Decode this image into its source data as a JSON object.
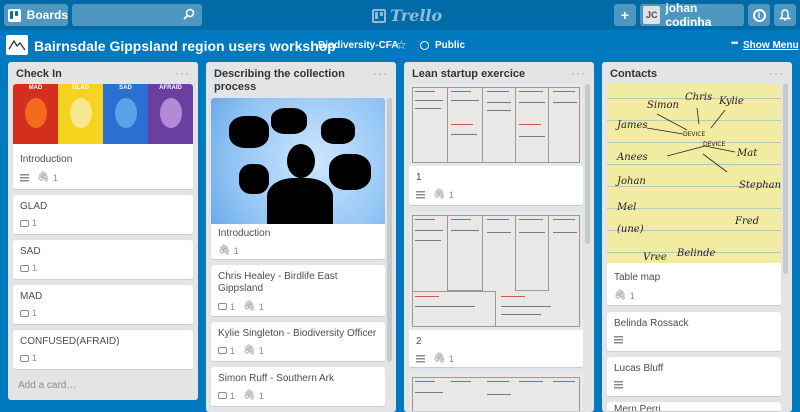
{
  "topbar": {
    "boards_label": "Boards",
    "search": {
      "placeholder": "",
      "value": ""
    },
    "logo_text": "Trello",
    "add_label": "+",
    "user": {
      "initials": "JC",
      "name": "johan codinha"
    },
    "info_label": "i",
    "bell_label": "🔔"
  },
  "board": {
    "title": "Bairnsdale Gippsland region users workshop",
    "team": "Biodiversity-CFA",
    "visibility": "Public",
    "show_menu": "Show Menu",
    "menu_dots": "•••"
  },
  "icons": {
    "star": "☆",
    "clip": "🖇",
    "description": "description-icon",
    "comment": "comment-icon",
    "attachment": "attachment-icon"
  },
  "lists": [
    {
      "title": "Check In",
      "menu": "···",
      "add_card": "Add a card…",
      "cover_labels": [
        "MAD",
        "GLAD",
        "SAD",
        "AFRAID"
      ],
      "cards": [
        {
          "title": "Introduction",
          "attachments": "1"
        },
        {
          "title": "GLAD",
          "comments": "1"
        },
        {
          "title": "SAD",
          "comments": "1"
        },
        {
          "title": "MAD",
          "comments": "1"
        },
        {
          "title": "CONFUSED(AFRAID)",
          "comments": "1"
        }
      ]
    },
    {
      "title": "Describing the collection process",
      "menu": "···",
      "cards": [
        {
          "title": "Introduction",
          "attachments": "1"
        },
        {
          "title": "Chris Healey - Birdlife East Gippsland",
          "comments": "1",
          "attachments": "1"
        },
        {
          "title": "Kylie Singleton - Biodiversity Officer",
          "comments": "1",
          "attachments": "1"
        },
        {
          "title": "Simon Ruff - Southern Ark",
          "comments": "1",
          "attachments": "1"
        }
      ]
    },
    {
      "title": "Lean startup exercice",
      "menu": "···",
      "cards": [
        {
          "title": "1",
          "attachments": "1"
        },
        {
          "title": "2",
          "attachments": "1"
        }
      ]
    },
    {
      "title": "Contacts",
      "menu": "···",
      "cards": [
        {
          "title": "Table map",
          "attachments": "1"
        },
        {
          "title": "Belinda Rossack"
        },
        {
          "title": "Lucas Bluff"
        },
        {
          "title": "Mern Perri"
        }
      ]
    }
  ]
}
